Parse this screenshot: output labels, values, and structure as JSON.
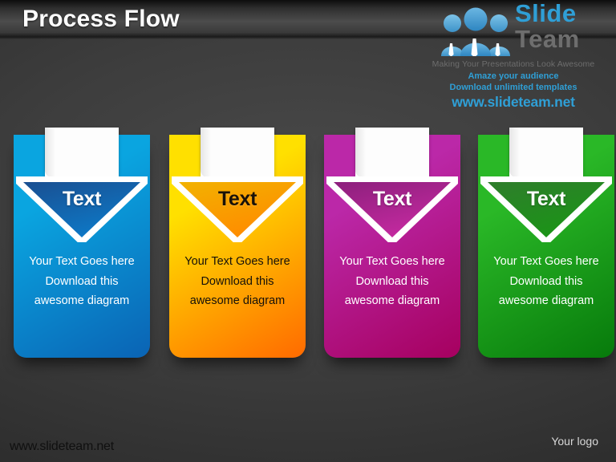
{
  "header": {
    "title": "Process Flow",
    "background_color": "#3a3a3a"
  },
  "logo": {
    "people_icon": "three-people-icon",
    "brand_primary": "Slide",
    "brand_secondary": "Team",
    "brand_primary_color": "#2f9fd6",
    "brand_secondary_color": "#6e6e6e",
    "tagline": "Making Your Presentations Look Awesome",
    "promo_line1": "Amaze your audience",
    "promo_line2": "Download unlimited templates",
    "site_url": "www.slideteam.net",
    "accent_color": "#2f9fd6"
  },
  "cards": [
    {
      "label": "Text",
      "body": "Your Text Goes here Download this awesome diagram",
      "color_light": "#0aa5e0",
      "color_dark": "#0a63b4",
      "tri_top": "#1a4f91",
      "tri_bottom": "#0d78c6",
      "text_tone": "light"
    },
    {
      "label": "Text",
      "body": "Your Text Goes here Download this awesome diagram",
      "color_light": "#ffe000",
      "color_dark": "#ff6a00",
      "tri_top": "#f2b200",
      "tri_bottom": "#ff8c00",
      "text_tone": "dark"
    },
    {
      "label": "Text",
      "body": "Your Text Goes here Download this awesome diagram",
      "color_light": "#bb28a8",
      "color_dark": "#a6005f",
      "tri_top": "#8c1f7c",
      "tri_bottom": "#c42aa0",
      "text_tone": "light"
    },
    {
      "label": "Text",
      "body": "Your Text Goes here Download this awesome diagram",
      "color_light": "#2ab827",
      "color_dark": "#077a0b",
      "tri_top": "#2f7d2c",
      "tri_bottom": "#1b9417",
      "text_tone": "light"
    }
  ],
  "footer": {
    "url": "www.slideteam.net",
    "logo_placeholder": "Your logo"
  }
}
